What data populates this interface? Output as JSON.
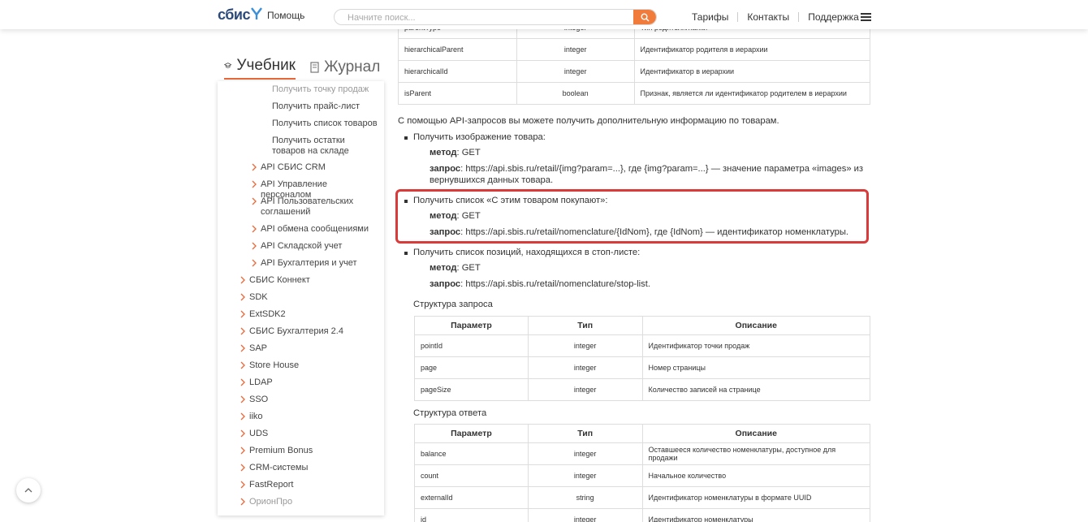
{
  "header": {
    "logo_text": "сбис",
    "help_label": "Помощь",
    "search_placeholder": "Начните поиск...",
    "nav": [
      "Тарифы",
      "Контакты",
      "Поддержка"
    ],
    "accent_color": "#f07b3a"
  },
  "sidebar": {
    "tabs": [
      {
        "label": "Учебник",
        "icon": "graduation-cap-icon",
        "active": true
      },
      {
        "label": "Журнал",
        "icon": "book-icon",
        "active": false
      }
    ],
    "subitems": [
      {
        "label": "Получить точку продаж",
        "faded": true
      },
      {
        "label": "Получить прайс-лист"
      },
      {
        "label": "Получить список товаров"
      },
      {
        "label": "Получить остатки товаров на складе"
      }
    ],
    "api_items": [
      "API СБИС CRM",
      "API Управление персоналом",
      "API Пользовательских соглашений",
      "API обмена сообщениями",
      "API Складской учет",
      "API Бухгалтерия и учет"
    ],
    "top_items": [
      "СБИС Коннект",
      "SDK",
      "ExtSDK2",
      "СБИС Бухгалтерия 2.4",
      "SAP",
      "Store House",
      "LDAP",
      "SSO",
      "iiko",
      "UDS",
      "Premium Bonus",
      "CRM-системы",
      "FastReport",
      "ОрионПро"
    ]
  },
  "content": {
    "top_table": [
      {
        "param": "parentType",
        "type": "integer",
        "desc": "Тип родителя/папки"
      },
      {
        "param": "hierarchicalParent",
        "type": "integer",
        "desc": "Идентификатор родителя в иерархии"
      },
      {
        "param": "hierarchicalId",
        "type": "integer",
        "desc": "Идентификатор в иерархии"
      },
      {
        "param": "isParent",
        "type": "boolean",
        "desc": "Признак, является ли идентификатор родителем в иерархии"
      }
    ],
    "intro": "С помощью API-запросов вы можете получить дополнительную информацию по товарам.",
    "method_label": "метод",
    "request_label": "запрос",
    "bullets": [
      {
        "title": "Получить изображение товара:",
        "method": ": GET",
        "request_1": ": https://api.sbis.ru/retail/{img?param=...}, где {img?param=...} — значение параметра «images» из",
        "request_2": "вернувшихся данных товара."
      },
      {
        "title": "Получить список «С этим товаром покупают»:",
        "method": ": GET",
        "request_1": ": https://api.sbis.ru/retail/nomenclature/{IdNom}, где {IdNom} — идентификатор номенклатуры."
      },
      {
        "title": "Получить список позиций, находящихся в стоп-листе:",
        "method": ": GET",
        "request_1": ": https://api.sbis.ru/retail/nomenclature/stop-list."
      }
    ],
    "request_structure_title": "Структура запроса",
    "response_structure_title": "Структура ответа",
    "headers": [
      "Параметр",
      "Тип",
      "Описание"
    ],
    "request_table": [
      {
        "param": "pointId",
        "type": "integer",
        "desc": "Идентификатор точки продаж"
      },
      {
        "param": "page",
        "type": "integer",
        "desc": "Номер страницы"
      },
      {
        "param": "pageSize",
        "type": "integer",
        "desc": "Количество записей на странице"
      }
    ],
    "response_table": [
      {
        "param": "balance",
        "type": "integer",
        "desc": "Оставшееся количество номенклатуры, доступное для продажи"
      },
      {
        "param": "count",
        "type": "integer",
        "desc": "Начальное количество"
      },
      {
        "param": "externalId",
        "type": "string",
        "desc": "Идентификатор номенклатуры в формате UUID"
      },
      {
        "param": "id",
        "type": "integer",
        "desc": "Идентификатор номенклатуры"
      }
    ],
    "highlight_color": "#d93a3a"
  }
}
